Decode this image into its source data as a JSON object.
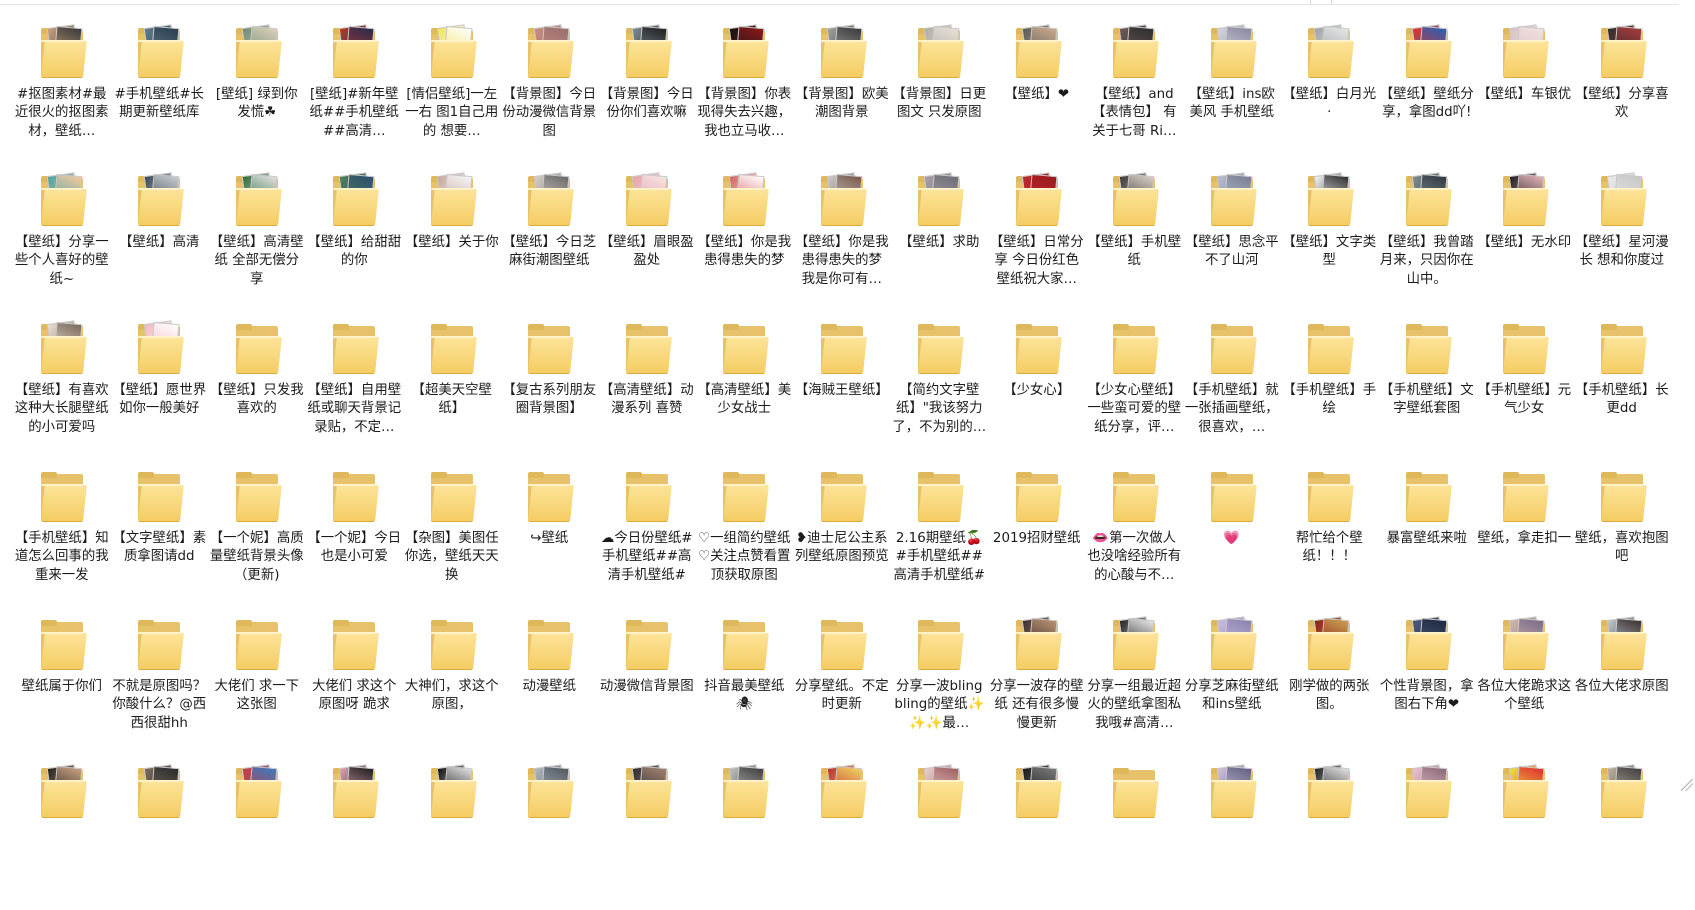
{
  "colors": {
    "folder": "#f4cc63",
    "text": "#1b1b1b",
    "background": "#ffffff"
  },
  "folders": [
    {
      "label": "#抠图素材#最近很火的抠图素材，壁纸…",
      "preview": [
        "#c8a07a",
        "#3a3a3a"
      ]
    },
    {
      "label": "#手机壁纸#长期更新壁纸库",
      "preview": [
        "#5f7c8c",
        "#2c3e50"
      ]
    },
    {
      "label": "[壁纸] 绿到你发慌☘",
      "preview": [
        "#6e8b73",
        "#d9d0b8"
      ]
    },
    {
      "label": "[壁纸]#新年壁纸##手机壁纸##高清…",
      "preview": [
        "#b03a2e",
        "#2b2b4d"
      ]
    },
    {
      "label": "[情侣壁纸]一左一右 图1自己用的 想要…",
      "preview": [
        "#f0e460",
        "#ffffff"
      ]
    },
    {
      "label": "【背景图】今日份动漫微信背景图",
      "preview": [
        "#c98c7f",
        "#9a6f6f"
      ]
    },
    {
      "label": "【背景图】今日份你们喜欢嘛",
      "preview": [
        "#7c8a95",
        "#202020"
      ]
    },
    {
      "label": "【背景图】你表现得失去兴趣，我也立马收…",
      "preview": [
        "#141414",
        "#8a1a1a"
      ]
    },
    {
      "label": "【背景图】欧美潮图背景",
      "preview": [
        "#a0a0a0",
        "#3b3b3b"
      ]
    },
    {
      "label": "【背景图】日更图文 只发原图",
      "preview": [
        "#b0aca6",
        "#e7e0d8"
      ]
    },
    {
      "label": "【壁纸】❤",
      "preview": [
        "#5a5a5a",
        "#caa98c"
      ]
    },
    {
      "label": "【壁纸】and 【表情包】 有关于七哥 Ri…",
      "preview": [
        "#6d5a5a",
        "#2e2e2e"
      ]
    },
    {
      "label": "【壁纸】ins欧美风 手机壁纸",
      "preview": [
        "#d5d5e0",
        "#8a8aa0"
      ]
    },
    {
      "label": "【壁纸】白月光·",
      "preview": [
        "#9fa3a8",
        "#e5e5e5"
      ]
    },
    {
      "label": "【壁纸】壁纸分享，拿图dd吖!",
      "preview": [
        "#e0342b",
        "#2b5fb3"
      ]
    },
    {
      "label": "【壁纸】车银优",
      "preview": [
        "#d9c3c6",
        "#f0e0e0"
      ]
    },
    {
      "label": "【壁纸】分享喜欢",
      "preview": [
        "#2f2f2f",
        "#a83a3a"
      ]
    },
    {
      "label": "【壁纸】分享一些个人喜好的壁纸~",
      "preview": [
        "#4aa3a2",
        "#f1c9a0"
      ]
    },
    {
      "label": "【壁纸】高清",
      "preview": [
        "#3b4a55",
        "#c9ccd0"
      ]
    },
    {
      "label": "【壁纸】高清壁纸 全部无偿分享",
      "preview": [
        "#2e6e3b",
        "#e0e0e0"
      ]
    },
    {
      "label": "【壁纸】给甜甜的你",
      "preview": [
        "#4e7f5a",
        "#2f4f6f"
      ]
    },
    {
      "label": "【壁纸】关于你",
      "preview": [
        "#c7a6a0",
        "#f5f5f5"
      ]
    },
    {
      "label": "【壁纸】今日芝麻街潮图壁纸",
      "preview": [
        "#d7d0c8",
        "#6a6a6a"
      ]
    },
    {
      "label": "【壁纸】眉眼盈盈处",
      "preview": [
        "#e5a2a8",
        "#f7e3e3"
      ]
    },
    {
      "label": "【壁纸】你是我患得患失的梦",
      "preview": [
        "#d86060",
        "#ffffff"
      ]
    },
    {
      "label": "【壁纸】你是我患得患失的梦 我是你可有…",
      "preview": [
        "#c9c9c9",
        "#7a5a4a"
      ]
    },
    {
      "label": "【壁纸】求助",
      "preview": [
        "#a8a0a8",
        "#6e6e78"
      ]
    },
    {
      "label": "【壁纸】日常分享 今日份红色壁纸祝大家…",
      "preview": [
        "#c1272d",
        "#9b1a1f"
      ]
    },
    {
      "label": "【壁纸】手机壁纸",
      "preview": [
        "#3a3a3a",
        "#d9cfc2"
      ]
    },
    {
      "label": "【壁纸】思念平不了山河",
      "preview": [
        "#b7bdd0",
        "#7a7f95"
      ]
    },
    {
      "label": "【壁纸】文字类型",
      "preview": [
        "#f3f3f3",
        "#303030"
      ]
    },
    {
      "label": "【壁纸】我曾踏月来，只因你在山中。",
      "preview": [
        "#7d8e92",
        "#2f3a40"
      ]
    },
    {
      "label": "【壁纸】无水印",
      "preview": [
        "#1f1f1f",
        "#e3b2b8"
      ]
    },
    {
      "label": "【壁纸】星河漫长 想和你度过",
      "preview": [
        "#ebebeb",
        "#c6c6c6"
      ]
    },
    {
      "label": "【壁纸】有喜欢这种大长腿壁纸的小可爱吗",
      "preview": [
        "#ece0d4",
        "#7a6a5c"
      ]
    },
    {
      "label": "【壁纸】愿世界如你一般美好",
      "preview": [
        "#f2b8c2",
        "#ffffff"
      ]
    },
    {
      "label": "【壁纸】只发我喜欢的",
      "preview": null
    },
    {
      "label": "【壁纸】自用壁纸或聊天背景记录贴，不定…",
      "preview": null
    },
    {
      "label": "【超美天空壁纸】",
      "preview": null
    },
    {
      "label": "【复古系列朋友圈背景图】",
      "preview": null
    },
    {
      "label": "【高清壁纸】动漫系列 喜赞",
      "preview": null
    },
    {
      "label": "【高清壁纸】美少女战士",
      "preview": null
    },
    {
      "label": "【海贼王壁纸】",
      "preview": null
    },
    {
      "label": "【简约文字壁纸】\"我该努力了，不为别的…",
      "preview": null
    },
    {
      "label": "【少女心】",
      "preview": null
    },
    {
      "label": "【少女心壁纸】一些蛮可爱的壁纸分享，评…",
      "preview": null
    },
    {
      "label": "【手机壁纸】就一张插画壁纸，很喜欢，…",
      "preview": null
    },
    {
      "label": "【手机壁纸】手绘",
      "preview": null
    },
    {
      "label": "【手机壁纸】文字壁纸套图",
      "preview": null
    },
    {
      "label": "【手机壁纸】元气少女",
      "preview": null
    },
    {
      "label": "【手机壁纸】长更dd",
      "preview": null
    },
    {
      "label": "【手机壁纸】知道怎么回事的我重来一发",
      "preview": null
    },
    {
      "label": "【文字壁纸】素质拿图请dd",
      "preview": null
    },
    {
      "label": "【一个妮】高质量壁纸背景头像（更新)",
      "preview": null
    },
    {
      "label": "【一个妮】今日也是小可爱",
      "preview": null
    },
    {
      "label": "【杂图】美图任你选，壁纸天天换",
      "preview": null
    },
    {
      "label": "↪壁纸",
      "preview": null
    },
    {
      "label": "☁今日份壁纸#手机壁纸##高清手机壁纸#",
      "preview": null
    },
    {
      "label": "♡一组简约壁纸♡关注点赞看置顶获取原图",
      "preview": null
    },
    {
      "label": "❥迪士尼公主系列壁纸原图预览",
      "preview": null
    },
    {
      "label": "2.16期壁纸🍒#手机壁纸##高清手机壁纸#",
      "preview": null
    },
    {
      "label": "2019招财壁纸",
      "preview": null
    },
    {
      "label": "👄第一次做人 也没啥经验所有的心酸与不…",
      "preview": null
    },
    {
      "label": "💗",
      "preview": null
    },
    {
      "label": "帮忙给个壁纸！！！",
      "preview": null
    },
    {
      "label": "暴富壁纸来啦",
      "preview": null
    },
    {
      "label": "壁纸，拿走扣一",
      "preview": null
    },
    {
      "label": "壁纸，喜欢抱图吧",
      "preview": null
    },
    {
      "label": "壁纸属于你们",
      "preview": null
    },
    {
      "label": "不就是原图吗？你酸什么？@西西很甜hh",
      "preview": null
    },
    {
      "label": "大佬们 求一下这张图",
      "preview": null
    },
    {
      "label": "大佬们 求这个原图呀 跪求",
      "preview": null
    },
    {
      "label": "大神们，求这个原图，",
      "preview": null
    },
    {
      "label": "动漫壁纸",
      "preview": null
    },
    {
      "label": "动漫微信背景图",
      "preview": null
    },
    {
      "label": "抖音最美壁纸🕷",
      "preview": null
    },
    {
      "label": "分享壁纸。不定时更新",
      "preview": null
    },
    {
      "label": "分享一波bling bling的壁纸✨✨✨最…",
      "preview": null
    },
    {
      "label": "分享一波存的壁纸 还有很多慢慢更新",
      "preview": [
        "#3a3030",
        "#b89070"
      ]
    },
    {
      "label": "分享一组最近超火的壁纸拿图私我哦#高清…",
      "preview": [
        "#222222",
        "#e5e5e5"
      ]
    },
    {
      "label": "分享芝麻街壁纸 和ins壁纸",
      "preview": [
        "#c8bde0",
        "#8d82b0"
      ]
    },
    {
      "label": "刚学做的两张图。",
      "preview": [
        "#8b1d1d",
        "#c9a050"
      ]
    },
    {
      "label": "个性背景图，拿图右下角❤",
      "preview": [
        "#4a5a7a",
        "#1f2a40"
      ]
    },
    {
      "label": "各位大佬跪求这个壁纸",
      "preview": [
        "#d0b8a8",
        "#7a6a8a"
      ]
    },
    {
      "label": "各位大佬求原图",
      "preview": [
        "#c0c8d0",
        "#3b3030"
      ]
    },
    {
      "label": "",
      "preview": [
        "#222222",
        "#c9a080"
      ]
    },
    {
      "label": "",
      "preview": [
        "#7a6a5a",
        "#2c2c2c"
      ]
    },
    {
      "label": "",
      "preview": [
        "#d03a3a",
        "#3a7ac0"
      ]
    },
    {
      "label": "",
      "preview": [
        "#e0a0b0",
        "#202020"
      ]
    },
    {
      "label": "",
      "preview": [
        "#101010",
        "#e0e0e0"
      ]
    },
    {
      "label": "",
      "preview": [
        "#b0b8c0",
        "#505860"
      ]
    },
    {
      "label": "",
      "preview": [
        "#303030",
        "#a08070"
      ]
    },
    {
      "label": "",
      "preview": [
        "#c0c0c0",
        "#404040"
      ]
    },
    {
      "label": "",
      "preview": [
        "#c03030",
        "#f0d060"
      ]
    },
    {
      "label": "",
      "preview": [
        "#e8d0d0",
        "#a06060"
      ]
    },
    {
      "label": "",
      "preview": [
        "#1a1a1a",
        "#7a7a7a"
      ]
    },
    {
      "label": "",
      "preview": null
    },
    {
      "label": "",
      "preview": [
        "#d0c0e0",
        "#606080"
      ]
    },
    {
      "label": "",
      "preview": [
        "#202020",
        "#e0e0e0"
      ]
    },
    {
      "label": "",
      "preview": [
        "#f0c0d0",
        "#8a6a7a"
      ]
    },
    {
      "label": "",
      "preview": [
        "#f0e040",
        "#e03030"
      ]
    },
    {
      "label": "",
      "preview": [
        "#c0b0a0",
        "#404040"
      ]
    }
  ]
}
